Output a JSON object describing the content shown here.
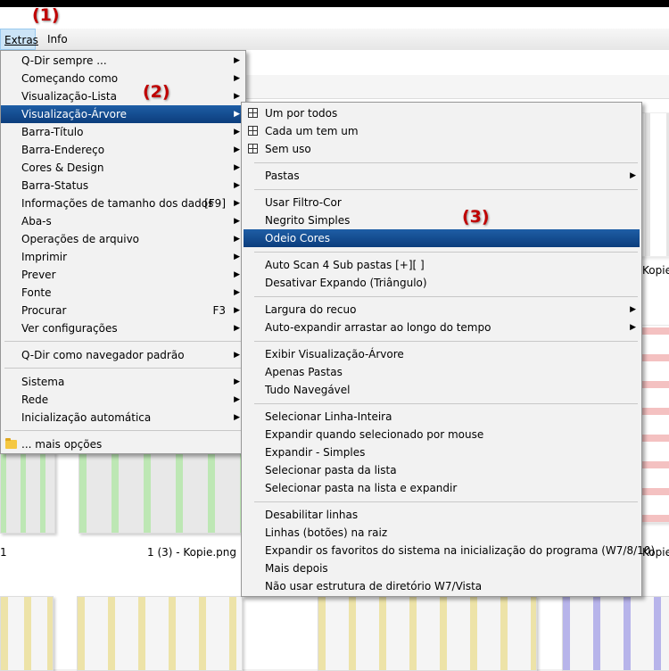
{
  "menubar": {
    "extras": "Extras",
    "info": "Info"
  },
  "annotations": [
    "(1)",
    "(2)",
    "(3)"
  ],
  "background": {
    "captions": [
      "Kopie",
      "1 (3) - Kopie.png",
      "Kopie",
      "1"
    ]
  },
  "extras_menu": {
    "items": [
      {
        "label": "Q-Dir sempre ...",
        "submenu": true
      },
      {
        "label": "Começando como",
        "submenu": true
      },
      {
        "label": "Visualização-Lista",
        "submenu": true
      },
      {
        "label": "Visualização-Árvore",
        "submenu": true,
        "highlighted": true
      },
      {
        "label": "Barra-Título",
        "submenu": true
      },
      {
        "label": "Barra-Endereço",
        "submenu": true
      },
      {
        "label": "Cores & Design",
        "submenu": true
      },
      {
        "label": "Barra-Status",
        "submenu": true
      },
      {
        "label": "Informações de tamanho dos dados",
        "shortcut": "[F9]",
        "submenu": true
      },
      {
        "label": "Aba-s",
        "submenu": true
      },
      {
        "label": "Operações de arquivo",
        "submenu": true
      },
      {
        "label": "Imprimir",
        "submenu": true
      },
      {
        "label": "Prever",
        "submenu": true
      },
      {
        "label": "Fonte",
        "submenu": true
      },
      {
        "label": "Procurar",
        "shortcut": "F3",
        "submenu": true
      },
      {
        "label": "Ver configurações",
        "submenu": true
      },
      {
        "label": "Q-Dir como navegador padrão",
        "submenu": true
      },
      {
        "label": "Sistema",
        "submenu": true
      },
      {
        "label": "Rede",
        "submenu": true
      },
      {
        "label": "Inicialização automática",
        "submenu": true
      },
      {
        "label": "... mais opções",
        "submenu": false
      }
    ]
  },
  "tree_menu": {
    "items": [
      {
        "label": "Um por todos",
        "icon": "grid-icon"
      },
      {
        "label": "Cada um tem um",
        "icon": "grid-icon"
      },
      {
        "label": "Sem uso",
        "icon": "grid-icon"
      },
      {
        "label": "Pastas",
        "submenu": true
      },
      {
        "label": "Usar Filtro-Cor"
      },
      {
        "label": "Negrito Simples"
      },
      {
        "label": "Odeio Cores",
        "highlighted": true
      },
      {
        "label": "Auto Scan 4 Sub pastas [+][ ]"
      },
      {
        "label": "Desativar Expando (Triângulo)"
      },
      {
        "label": "Largura do recuo",
        "submenu": true
      },
      {
        "label": "Auto-expandir arrastar ao longo do tempo",
        "submenu": true
      },
      {
        "label": "Exibir Visualização-Árvore"
      },
      {
        "label": "Apenas Pastas"
      },
      {
        "label": "Tudo Navegável"
      },
      {
        "label": "Selecionar Linha-Inteira"
      },
      {
        "label": "Expandir quando selecionado por mouse"
      },
      {
        "label": "Expandir - Simples"
      },
      {
        "label": "Selecionar pasta da lista"
      },
      {
        "label": "Selecionar pasta na lista e expandir"
      },
      {
        "label": "Desabilitar linhas"
      },
      {
        "label": "Linhas (botões) na raiz"
      },
      {
        "label": "Expandir os favoritos do sistema na inicialização do programa (W7/8/10)"
      },
      {
        "label": "Mais depois"
      },
      {
        "label": "Não usar estrutura de diretório W7/Vista"
      }
    ]
  },
  "colors": {
    "highlight": "#1e5ea6",
    "annotation": "#c00000"
  }
}
